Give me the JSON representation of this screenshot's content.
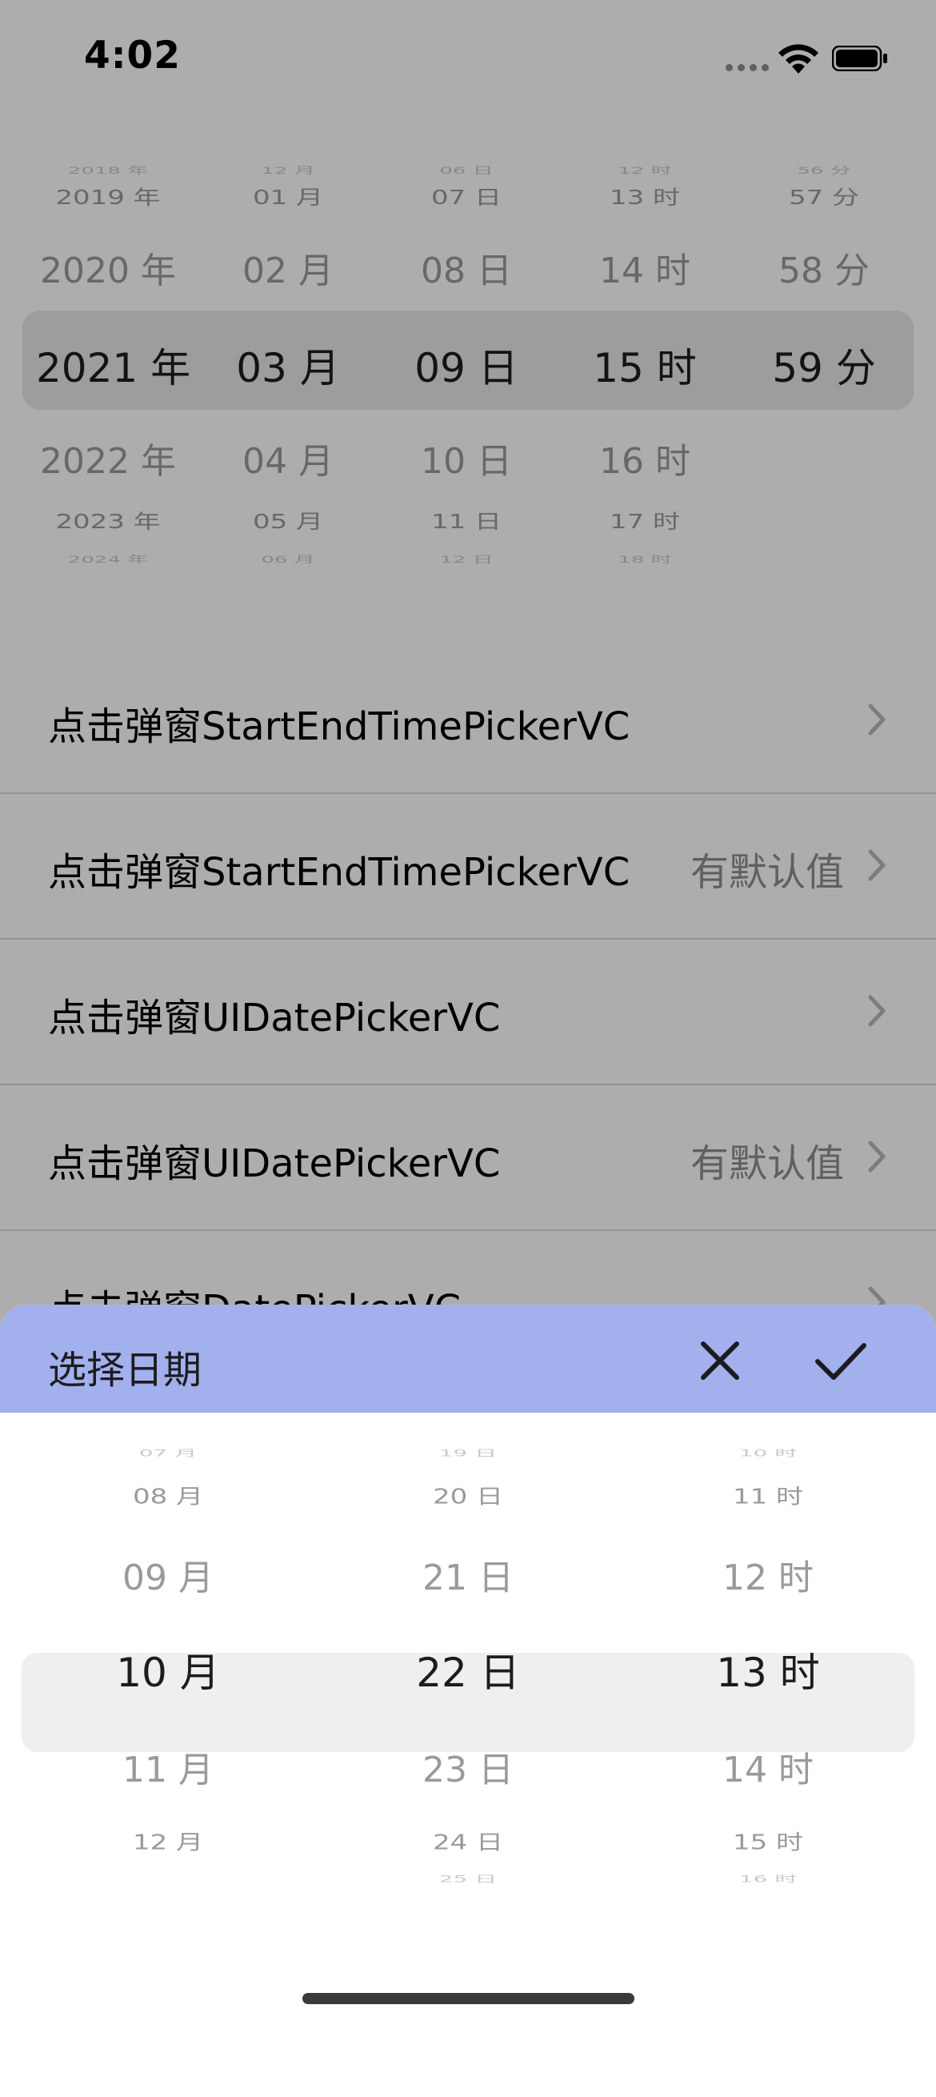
{
  "status_bar": {
    "time": "4:02",
    "icons": [
      "cellular-signal-icon",
      "wifi-icon",
      "battery-icon"
    ]
  },
  "top_picker": {
    "columns": [
      {
        "name": "year",
        "items": [
          "2018 年",
          "2019 年",
          "2020 年",
          "2021 年",
          "2022 年",
          "2023 年",
          "2024 年"
        ],
        "selected": "2021 年"
      },
      {
        "name": "month",
        "items": [
          "12 月",
          "01 月",
          "02 月",
          "03 月",
          "04 月",
          "05 月",
          "06 月"
        ],
        "selected": "03 月"
      },
      {
        "name": "day",
        "items": [
          "06 日",
          "07 日",
          "08 日",
          "09 日",
          "10 日",
          "11 日",
          "12 日"
        ],
        "selected": "09 日"
      },
      {
        "name": "hour",
        "items": [
          "12 时",
          "13 时",
          "14 时",
          "15 时",
          "16 时",
          "17 时",
          "18 时"
        ],
        "selected": "15 时"
      },
      {
        "name": "minute",
        "items": [
          "56 分",
          "57 分",
          "58 分",
          "59 分",
          "",
          "",
          ""
        ],
        "selected": "59 分"
      }
    ]
  },
  "list": {
    "rows": [
      {
        "title": "点击弹窗StartEndTimePickerVC",
        "detail": ""
      },
      {
        "title": "点击弹窗StartEndTimePickerVC",
        "detail": "有默认值"
      },
      {
        "title": "点击弹窗UIDatePickerVC",
        "detail": ""
      },
      {
        "title": "点击弹窗UIDatePickerVC",
        "detail": "有默认值"
      },
      {
        "title": "点击弹窗DatePickerVC",
        "detail": ""
      }
    ]
  },
  "sheet": {
    "title": "选择日期",
    "close_icon": "close-icon",
    "confirm_icon": "checkmark-icon",
    "header_color": "#a3b0ee",
    "columns": [
      {
        "name": "month",
        "items": [
          "07 月",
          "08 月",
          "09 月",
          "10 月",
          "11 月",
          "12 月",
          ""
        ],
        "selected": "10 月"
      },
      {
        "name": "day",
        "items": [
          "19 日",
          "20 日",
          "21 日",
          "22 日",
          "23 日",
          "24 日",
          "25 日"
        ],
        "selected": "22 日"
      },
      {
        "name": "hour",
        "items": [
          "10 时",
          "11 时",
          "12 时",
          "13 时",
          "14 时",
          "15 时",
          "16 时"
        ],
        "selected": "13 时"
      }
    ]
  }
}
